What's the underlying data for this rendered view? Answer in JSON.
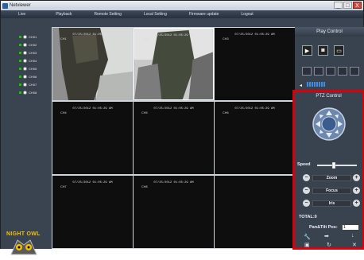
{
  "window": {
    "title": "Netviewer",
    "buttons": [
      "_",
      "□",
      "X"
    ]
  },
  "menu": [
    "Live",
    "Playback",
    "Remote Setting",
    "Local Setting",
    "Firmware update",
    "Logout"
  ],
  "channels": [
    "CH01",
    "CH02",
    "CH03",
    "CH04",
    "CH05",
    "CH06",
    "CH07",
    "CH08"
  ],
  "logo": {
    "text": "NIGHT OWL"
  },
  "cells": [
    {
      "cap": "07/25/2012 01:05:29 AM",
      "id": "CH1"
    },
    {
      "cap": "07/25/2012 01:05:29 AM",
      "id": "CH2"
    },
    {
      "cap": "07/25/2012 01:05:29 AM",
      "id": "CH3"
    },
    {
      "cap": "07/25/2012 01:05:29 AM",
      "id": "CH4"
    },
    {
      "cap": "07/25/2012 01:05:29 AM",
      "id": "CH5"
    },
    {
      "cap": "07/25/2012 01:05:29 AM",
      "id": "CH6"
    },
    {
      "cap": "07/25/2012 01:05:29 AM",
      "id": "CH7"
    },
    {
      "cap": "07/25/2012 01:05:29 AM",
      "id": "CH8"
    },
    {
      "cap": "",
      "id": ""
    }
  ],
  "play_control": {
    "title": "Play Control"
  },
  "ptz": {
    "title": "PTZ Control",
    "speed_label": "Speed",
    "zoom_label": "Zoom",
    "focus_label": "Focus",
    "iris_label": "Iris",
    "total_label": "TOTAL:0",
    "pos_label": "Pan&Tilt Pos:",
    "pos_value": "1"
  }
}
